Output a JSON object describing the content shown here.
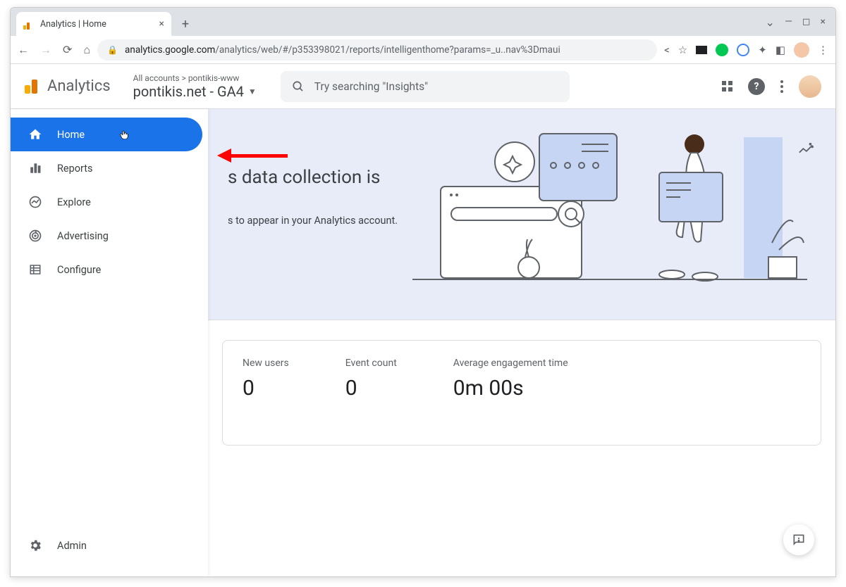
{
  "browser": {
    "tab_title": "Analytics | Home",
    "url_host": "analytics.google.com",
    "url_path": "/analytics/web/#/p353398021/reports/intelligenthome?params=_u..nav%3Dmaui"
  },
  "header": {
    "product_name": "Analytics",
    "breadcrumb": "All accounts > pontikis-www",
    "property": "pontikis.net - GA4",
    "search_placeholder": "Try searching \"Insights\""
  },
  "sidebar": {
    "items": [
      {
        "label": "Home",
        "icon": "home-icon"
      },
      {
        "label": "Reports",
        "icon": "reports-icon"
      },
      {
        "label": "Explore",
        "icon": "explore-icon"
      },
      {
        "label": "Advertising",
        "icon": "advertising-icon"
      },
      {
        "label": "Configure",
        "icon": "configure-icon"
      }
    ],
    "admin_label": "Admin"
  },
  "hero": {
    "title_fragment": "s data collection is",
    "subtitle_fragment": "s to appear in your Analytics account."
  },
  "metrics": [
    {
      "label": "New users",
      "value": "0"
    },
    {
      "label": "Event count",
      "value": "0"
    },
    {
      "label": "Average engagement time",
      "value": "0m 00s"
    }
  ]
}
